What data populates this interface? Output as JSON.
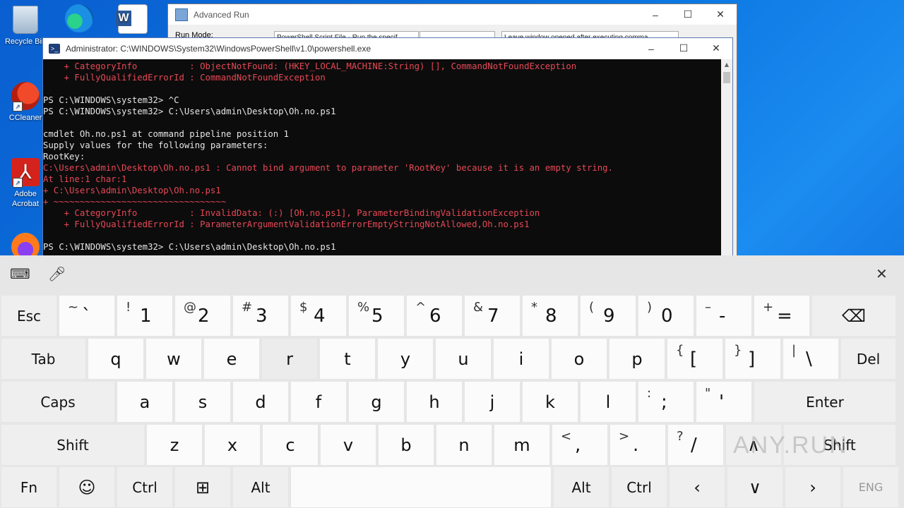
{
  "desktop": {
    "icons": [
      {
        "label": "Recycle Bin",
        "name": "recycle-bin"
      },
      {
        "label": "",
        "name": "edge"
      },
      {
        "label": "",
        "name": "word"
      },
      {
        "label": "CCleaner",
        "name": "ccleaner"
      },
      {
        "label": "Adobe Acrobat",
        "name": "acrobat"
      },
      {
        "label": "",
        "name": "firefox"
      }
    ]
  },
  "advanced_run": {
    "title": "Advanced Run",
    "run_mode_label": "Run Mode:",
    "run_mode_value": "PowerShell Script File - Run the specif",
    "option_value": "Leave window opened after executing comma"
  },
  "powershell": {
    "title": "Administrator: C:\\WINDOWS\\System32\\WindowsPowerShell\\v1.0\\powershell.exe",
    "lines": [
      {
        "text": "    + CategoryInfo          : ObjectNotFound: (HKEY_LOCAL_MACHINE:String) [], CommandNotFoundException",
        "color": "r"
      },
      {
        "text": "    + FullyQualifiedErrorId : CommandNotFoundException",
        "color": "r"
      },
      {
        "text": "",
        "color": "w"
      },
      {
        "text": "PS C:\\WINDOWS\\system32> ^C",
        "color": "w"
      },
      {
        "text": "PS C:\\WINDOWS\\system32> C:\\Users\\admin\\Desktop\\Oh.no.ps1",
        "color": "w"
      },
      {
        "text": "",
        "color": "w"
      },
      {
        "text": "cmdlet Oh.no.ps1 at command pipeline position 1",
        "color": "w"
      },
      {
        "text": "Supply values for the following parameters:",
        "color": "w"
      },
      {
        "text": "RootKey:",
        "color": "w"
      },
      {
        "text": "C:\\Users\\admin\\Desktop\\Oh.no.ps1 : Cannot bind argument to parameter 'RootKey' because it is an empty string.",
        "color": "r"
      },
      {
        "text": "At line:1 char:1",
        "color": "r"
      },
      {
        "text": "+ C:\\Users\\admin\\Desktop\\Oh.no.ps1",
        "color": "r"
      },
      {
        "text": "+ ~~~~~~~~~~~~~~~~~~~~~~~~~~~~~~~~~",
        "color": "r"
      },
      {
        "text": "    + CategoryInfo          : InvalidData: (:) [Oh.no.ps1], ParameterBindingValidationException",
        "color": "r"
      },
      {
        "text": "    + FullyQualifiedErrorId : ParameterArgumentValidationErrorEmptyStringNotAllowed,Oh.no.ps1",
        "color": "r"
      },
      {
        "text": "",
        "color": "w"
      },
      {
        "text": "PS C:\\WINDOWS\\system32> C:\\Users\\admin\\Desktop\\Oh.no.ps1",
        "color": "w"
      }
    ]
  },
  "keyboard": {
    "rows": [
      [
        {
          "name": "esc",
          "label": "Esc",
          "w": 80,
          "dark": true
        },
        {
          "name": "backtick",
          "sec": "~",
          "prim": "`",
          "w": 80
        },
        {
          "name": "1",
          "sec": "!",
          "prim": "1",
          "w": 80
        },
        {
          "name": "2",
          "sec": "@",
          "prim": "2",
          "w": 80
        },
        {
          "name": "3",
          "sec": "#",
          "prim": "3",
          "w": 80
        },
        {
          "name": "4",
          "sec": "$",
          "prim": "4",
          "w": 80
        },
        {
          "name": "5",
          "sec": "%",
          "prim": "5",
          "w": 80
        },
        {
          "name": "6",
          "sec": "^",
          "prim": "6",
          "w": 80
        },
        {
          "name": "7",
          "sec": "&",
          "prim": "7",
          "w": 80
        },
        {
          "name": "8",
          "sec": "*",
          "prim": "8",
          "w": 80
        },
        {
          "name": "9",
          "sec": "(",
          "prim": "9",
          "w": 80
        },
        {
          "name": "0",
          "sec": ")",
          "prim": "0",
          "w": 80
        },
        {
          "name": "minus",
          "sec": "–",
          "prim": "-",
          "w": 80
        },
        {
          "name": "equals",
          "sec": "+",
          "prim": "=",
          "w": 80
        },
        {
          "name": "backspace",
          "label": "⌫",
          "w": 120,
          "dark": true
        }
      ],
      [
        {
          "name": "tab",
          "label": "Tab",
          "w": 121,
          "dark": true
        },
        {
          "name": "q",
          "label": "q",
          "w": 80
        },
        {
          "name": "w",
          "label": "w",
          "w": 80
        },
        {
          "name": "e",
          "label": "e",
          "w": 80
        },
        {
          "name": "r",
          "label": "r",
          "w": 80,
          "pressed": true
        },
        {
          "name": "t",
          "label": "t",
          "w": 80
        },
        {
          "name": "y",
          "label": "y",
          "w": 80
        },
        {
          "name": "u",
          "label": "u",
          "w": 80
        },
        {
          "name": "i",
          "label": "i",
          "w": 80
        },
        {
          "name": "o",
          "label": "o",
          "w": 80
        },
        {
          "name": "p",
          "label": "p",
          "w": 80
        },
        {
          "name": "lbracket",
          "sec": "{",
          "prim": "[",
          "w": 80
        },
        {
          "name": "rbracket",
          "sec": "}",
          "prim": "]",
          "w": 80
        },
        {
          "name": "backslash",
          "sec": "|",
          "prim": "\\",
          "w": 80
        },
        {
          "name": "del",
          "label": "Del",
          "w": 79,
          "dark": true
        }
      ],
      [
        {
          "name": "caps",
          "label": "Caps",
          "w": 162,
          "dark": true
        },
        {
          "name": "a",
          "label": "a",
          "w": 80
        },
        {
          "name": "s",
          "label": "s",
          "w": 80
        },
        {
          "name": "d",
          "label": "d",
          "w": 80
        },
        {
          "name": "f",
          "label": "f",
          "w": 80
        },
        {
          "name": "g",
          "label": "g",
          "w": 80
        },
        {
          "name": "h",
          "label": "h",
          "w": 80
        },
        {
          "name": "j",
          "label": "j",
          "w": 80
        },
        {
          "name": "k",
          "label": "k",
          "w": 80
        },
        {
          "name": "l",
          "label": "l",
          "w": 80
        },
        {
          "name": "semicolon",
          "sec": ":",
          "prim": ";",
          "w": 80
        },
        {
          "name": "quote",
          "sec": "\"",
          "prim": "'",
          "w": 80
        },
        {
          "name": "enter",
          "label": "Enter",
          "w": 202,
          "dark": true
        }
      ],
      [
        {
          "name": "shift-left",
          "label": "Shift",
          "w": 204,
          "dark": true
        },
        {
          "name": "z",
          "label": "z",
          "w": 80
        },
        {
          "name": "x",
          "label": "x",
          "w": 80
        },
        {
          "name": "c",
          "label": "c",
          "w": 80
        },
        {
          "name": "v",
          "label": "v",
          "w": 80
        },
        {
          "name": "b",
          "label": "b",
          "w": 80
        },
        {
          "name": "n",
          "label": "n",
          "w": 80
        },
        {
          "name": "m",
          "label": "m",
          "w": 80
        },
        {
          "name": "comma",
          "sec": "<",
          "prim": ",",
          "w": 80
        },
        {
          "name": "period",
          "sec": ">",
          "prim": ".",
          "w": 80
        },
        {
          "name": "slash",
          "sec": "?",
          "prim": "/",
          "w": 80
        },
        {
          "name": "up",
          "label": "∧",
          "w": 80,
          "dark": true
        },
        {
          "name": "shift-right",
          "label": "Shift",
          "w": 160,
          "dark": true
        }
      ],
      [
        {
          "name": "fn",
          "label": "Fn",
          "w": 80,
          "dark": true
        },
        {
          "name": "emoji",
          "label": "☺",
          "w": 80,
          "dark": true
        },
        {
          "name": "ctrl-left",
          "label": "Ctrl",
          "w": 80,
          "dark": true
        },
        {
          "name": "windows",
          "label": "⊞",
          "w": 80,
          "dark": true
        },
        {
          "name": "alt-left",
          "label": "Alt",
          "w": 80,
          "dark": true
        },
        {
          "name": "space",
          "label": "",
          "w": 370
        },
        {
          "name": "alt-right",
          "label": "Alt",
          "w": 80,
          "dark": true
        },
        {
          "name": "ctrl-right",
          "label": "Ctrl",
          "w": 80,
          "dark": true
        },
        {
          "name": "left",
          "label": "‹",
          "w": 80,
          "dark": true
        },
        {
          "name": "down",
          "label": "∨",
          "w": 80,
          "dark": true
        },
        {
          "name": "right",
          "label": "›",
          "w": 80,
          "dark": true
        },
        {
          "name": "lang",
          "label": "ENG",
          "w": 80,
          "dark": true,
          "dim": true
        }
      ]
    ]
  },
  "watermark": "ANY.RUN"
}
